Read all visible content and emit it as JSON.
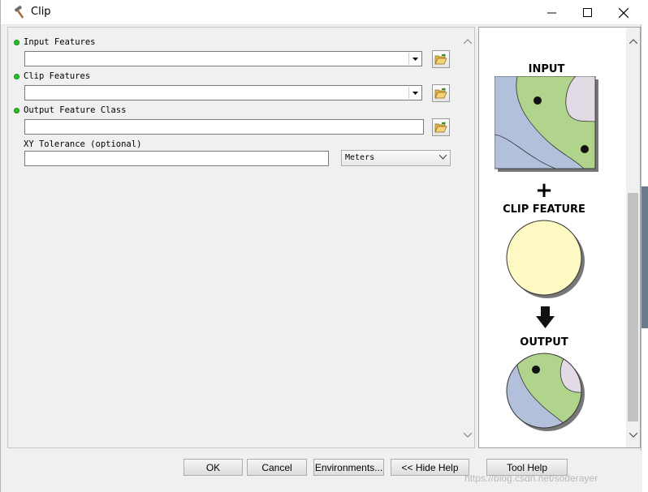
{
  "window": {
    "title": "Clip",
    "icon": "hammer-icon",
    "controls": [
      "minimize-icon",
      "maximize-icon",
      "close-icon"
    ]
  },
  "parameters": {
    "input_features": {
      "label": "Input Features",
      "value": "",
      "required": true
    },
    "clip_features": {
      "label": "Clip Features",
      "value": "",
      "required": true
    },
    "output_feature_class": {
      "label": "Output Feature Class",
      "value": "",
      "required": true
    },
    "xy_tolerance": {
      "label": "XY Tolerance (optional)",
      "value": "",
      "units": "Meters"
    }
  },
  "help": {
    "input_caption": "INPUT",
    "plus": "+",
    "clip_caption": "CLIP FEATURE",
    "output_caption": "OUTPUT"
  },
  "buttons": {
    "ok": "OK",
    "cancel": "Cancel",
    "environments": "Environments...",
    "hide_help": "<< Hide Help",
    "tool_help": "Tool Help"
  },
  "watermark": "https://blog.csdn.net/soderayer",
  "colors": {
    "required_dot": "#22c422",
    "input_green": "#b1d48c",
    "input_blue": "#b3c0dc",
    "input_lilac": "#e2dbe5",
    "clip_yellow": "#fff9c4"
  }
}
